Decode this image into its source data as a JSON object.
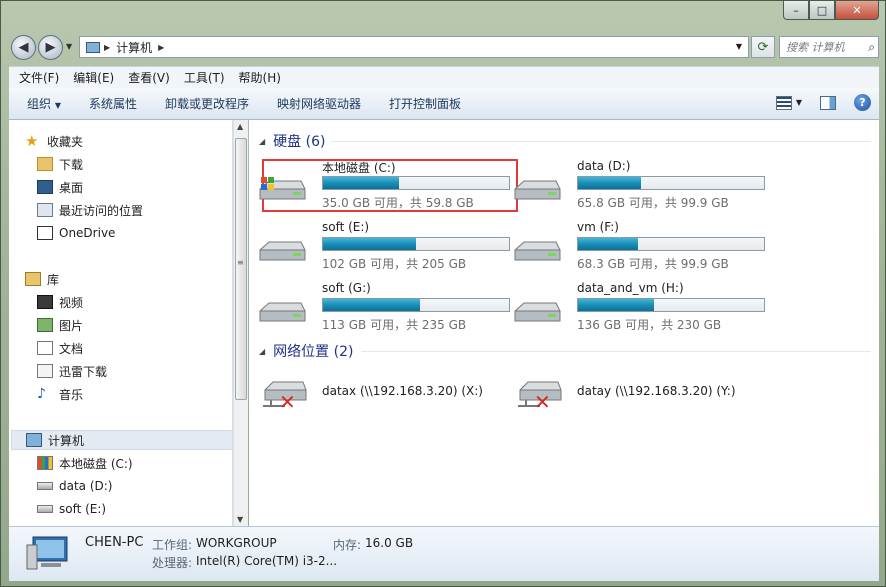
{
  "address": {
    "crumbs": [
      "计算机"
    ]
  },
  "search": {
    "placeholder": "搜索 计算机"
  },
  "menu": [
    "文件(F)",
    "编辑(E)",
    "查看(V)",
    "工具(T)",
    "帮助(H)"
  ],
  "commands": [
    "组织",
    "系统属性",
    "卸载或更改程序",
    "映射网络驱动器",
    "打开控制面板"
  ],
  "nav": {
    "favorites": "收藏夹",
    "fav_items": [
      "下载",
      "桌面",
      "最近访问的位置",
      "OneDrive"
    ],
    "libraries": "库",
    "lib_items": [
      "视频",
      "图片",
      "文档",
      "迅雷下载",
      "音乐"
    ],
    "computer": "计算机",
    "comp_items": [
      "本地磁盘 (C:)",
      "data (D:)",
      "soft (E:)"
    ]
  },
  "groups": {
    "hard_disks": "硬盘 (6)",
    "network": "网络位置 (2)"
  },
  "drives": [
    {
      "name": "本地磁盘 (C:)",
      "info": "35.0 GB 可用，共 59.8 GB",
      "used_fraction": 0.41
    },
    {
      "name": "data (D:)",
      "info": "65.8 GB 可用，共 99.9 GB",
      "used_fraction": 0.34
    },
    {
      "name": "soft (E:)",
      "info": "102 GB 可用，共 205 GB",
      "used_fraction": 0.5
    },
    {
      "name": "vm (F:)",
      "info": "68.3 GB 可用，共 99.9 GB",
      "used_fraction": 0.32
    },
    {
      "name": "soft (G:)",
      "info": "113 GB 可用，共 235 GB",
      "used_fraction": 0.52
    },
    {
      "name": "data_and_vm (H:)",
      "info": "136 GB 可用，共 230 GB",
      "used_fraction": 0.41
    }
  ],
  "network_drives": [
    {
      "name": "datax (\\\\192.168.3.20) (X:)"
    },
    {
      "name": "datay (\\\\192.168.3.20) (Y:)"
    }
  ],
  "details": {
    "pc_name": "CHEN-PC",
    "workgroup_label": "工作组:",
    "workgroup": "WORKGROUP",
    "memory_label": "内存:",
    "memory": "16.0 GB",
    "cpu_label": "处理器:",
    "cpu": "Intel(R) Core(TM) i3-2..."
  },
  "colors": {
    "highlight_box": "#e03a3a",
    "bar_fill": "#1a8fb8",
    "group_header": "#1e3287"
  }
}
